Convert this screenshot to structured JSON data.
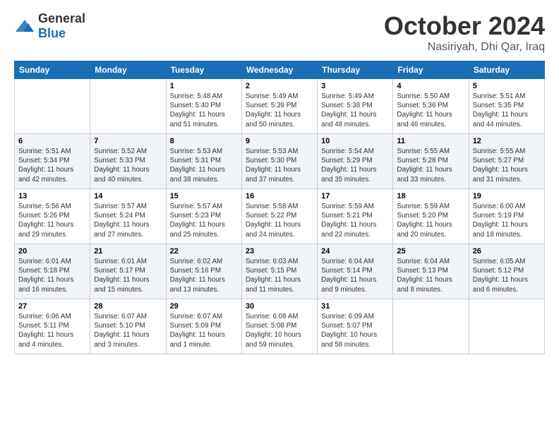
{
  "header": {
    "logo_general": "General",
    "logo_blue": "Blue",
    "title": "October 2024",
    "location": "Nasiriyah, Dhi Qar, Iraq"
  },
  "days_of_week": [
    "Sunday",
    "Monday",
    "Tuesday",
    "Wednesday",
    "Thursday",
    "Friday",
    "Saturday"
  ],
  "weeks": [
    [
      {
        "day": "",
        "info": ""
      },
      {
        "day": "",
        "info": ""
      },
      {
        "day": "1",
        "info": "Sunrise: 5:48 AM\nSunset: 5:40 PM\nDaylight: 11 hours and 51 minutes."
      },
      {
        "day": "2",
        "info": "Sunrise: 5:49 AM\nSunset: 5:39 PM\nDaylight: 11 hours and 50 minutes."
      },
      {
        "day": "3",
        "info": "Sunrise: 5:49 AM\nSunset: 5:38 PM\nDaylight: 11 hours and 48 minutes."
      },
      {
        "day": "4",
        "info": "Sunrise: 5:50 AM\nSunset: 5:36 PM\nDaylight: 11 hours and 46 minutes."
      },
      {
        "day": "5",
        "info": "Sunrise: 5:51 AM\nSunset: 5:35 PM\nDaylight: 11 hours and 44 minutes."
      }
    ],
    [
      {
        "day": "6",
        "info": "Sunrise: 5:51 AM\nSunset: 5:34 PM\nDaylight: 11 hours and 42 minutes."
      },
      {
        "day": "7",
        "info": "Sunrise: 5:52 AM\nSunset: 5:33 PM\nDaylight: 11 hours and 40 minutes."
      },
      {
        "day": "8",
        "info": "Sunrise: 5:53 AM\nSunset: 5:31 PM\nDaylight: 11 hours and 38 minutes."
      },
      {
        "day": "9",
        "info": "Sunrise: 5:53 AM\nSunset: 5:30 PM\nDaylight: 11 hours and 37 minutes."
      },
      {
        "day": "10",
        "info": "Sunrise: 5:54 AM\nSunset: 5:29 PM\nDaylight: 11 hours and 35 minutes."
      },
      {
        "day": "11",
        "info": "Sunrise: 5:55 AM\nSunset: 5:28 PM\nDaylight: 11 hours and 33 minutes."
      },
      {
        "day": "12",
        "info": "Sunrise: 5:55 AM\nSunset: 5:27 PM\nDaylight: 11 hours and 31 minutes."
      }
    ],
    [
      {
        "day": "13",
        "info": "Sunrise: 5:56 AM\nSunset: 5:26 PM\nDaylight: 11 hours and 29 minutes."
      },
      {
        "day": "14",
        "info": "Sunrise: 5:57 AM\nSunset: 5:24 PM\nDaylight: 11 hours and 27 minutes."
      },
      {
        "day": "15",
        "info": "Sunrise: 5:57 AM\nSunset: 5:23 PM\nDaylight: 11 hours and 25 minutes."
      },
      {
        "day": "16",
        "info": "Sunrise: 5:58 AM\nSunset: 5:22 PM\nDaylight: 11 hours and 24 minutes."
      },
      {
        "day": "17",
        "info": "Sunrise: 5:59 AM\nSunset: 5:21 PM\nDaylight: 11 hours and 22 minutes."
      },
      {
        "day": "18",
        "info": "Sunrise: 5:59 AM\nSunset: 5:20 PM\nDaylight: 11 hours and 20 minutes."
      },
      {
        "day": "19",
        "info": "Sunrise: 6:00 AM\nSunset: 5:19 PM\nDaylight: 11 hours and 18 minutes."
      }
    ],
    [
      {
        "day": "20",
        "info": "Sunrise: 6:01 AM\nSunset: 5:18 PM\nDaylight: 11 hours and 16 minutes."
      },
      {
        "day": "21",
        "info": "Sunrise: 6:01 AM\nSunset: 5:17 PM\nDaylight: 11 hours and 15 minutes."
      },
      {
        "day": "22",
        "info": "Sunrise: 6:02 AM\nSunset: 5:16 PM\nDaylight: 11 hours and 13 minutes."
      },
      {
        "day": "23",
        "info": "Sunrise: 6:03 AM\nSunset: 5:15 PM\nDaylight: 11 hours and 11 minutes."
      },
      {
        "day": "24",
        "info": "Sunrise: 6:04 AM\nSunset: 5:14 PM\nDaylight: 11 hours and 9 minutes."
      },
      {
        "day": "25",
        "info": "Sunrise: 6:04 AM\nSunset: 5:13 PM\nDaylight: 11 hours and 8 minutes."
      },
      {
        "day": "26",
        "info": "Sunrise: 6:05 AM\nSunset: 5:12 PM\nDaylight: 11 hours and 6 minutes."
      }
    ],
    [
      {
        "day": "27",
        "info": "Sunrise: 6:06 AM\nSunset: 5:11 PM\nDaylight: 11 hours and 4 minutes."
      },
      {
        "day": "28",
        "info": "Sunrise: 6:07 AM\nSunset: 5:10 PM\nDaylight: 11 hours and 3 minutes."
      },
      {
        "day": "29",
        "info": "Sunrise: 6:07 AM\nSunset: 5:09 PM\nDaylight: 11 hours and 1 minute."
      },
      {
        "day": "30",
        "info": "Sunrise: 6:08 AM\nSunset: 5:08 PM\nDaylight: 10 hours and 59 minutes."
      },
      {
        "day": "31",
        "info": "Sunrise: 6:09 AM\nSunset: 5:07 PM\nDaylight: 10 hours and 58 minutes."
      },
      {
        "day": "",
        "info": ""
      },
      {
        "day": "",
        "info": ""
      }
    ]
  ]
}
